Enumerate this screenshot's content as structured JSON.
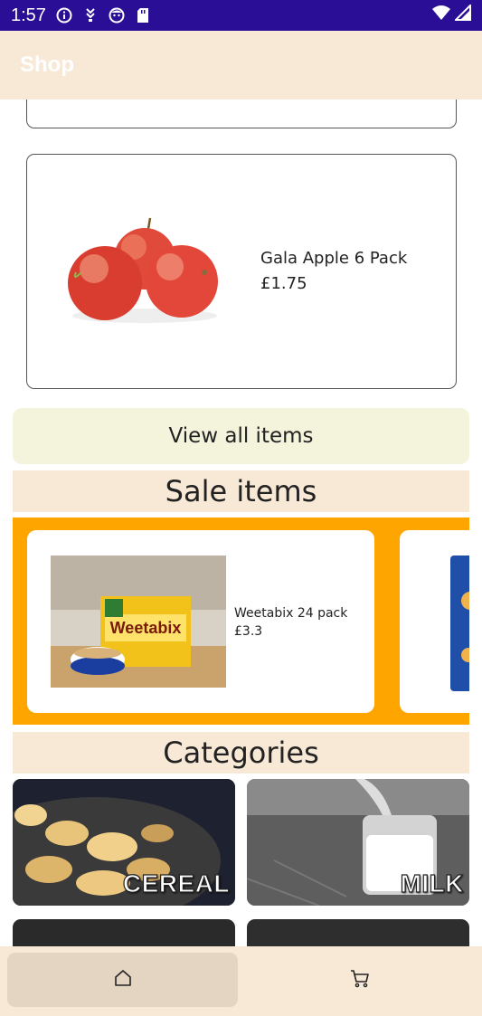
{
  "status_bar": {
    "time": "1:57",
    "icons": [
      "info-icon",
      "download-icon",
      "face-icon",
      "sd-card-icon",
      "wifi-icon",
      "signal-icon"
    ]
  },
  "app_bar": {
    "title": "Shop"
  },
  "featured_product": {
    "name": "Gala Apple 6 Pack",
    "price": "£1.75"
  },
  "view_all": {
    "label": "View all items"
  },
  "sale": {
    "title": "Sale items",
    "items": [
      {
        "name": "Weetabix 24 pack",
        "price": "£3.3",
        "brand_text": "Weetabix"
      }
    ]
  },
  "categories": {
    "title": "Categories",
    "items": [
      {
        "label": "CEREAL"
      },
      {
        "label": "MILK"
      }
    ]
  },
  "bottom_nav": {
    "items": [
      {
        "icon": "home-icon",
        "selected": true
      },
      {
        "icon": "cart-icon",
        "selected": false
      }
    ]
  },
  "colors": {
    "status_bar": "#2a0e96",
    "app_bar": "#f8e8d6",
    "view_all_bg": "#f4f4dc",
    "sale_band": "#ffa500",
    "nav_selected": "#e3d5c2"
  }
}
